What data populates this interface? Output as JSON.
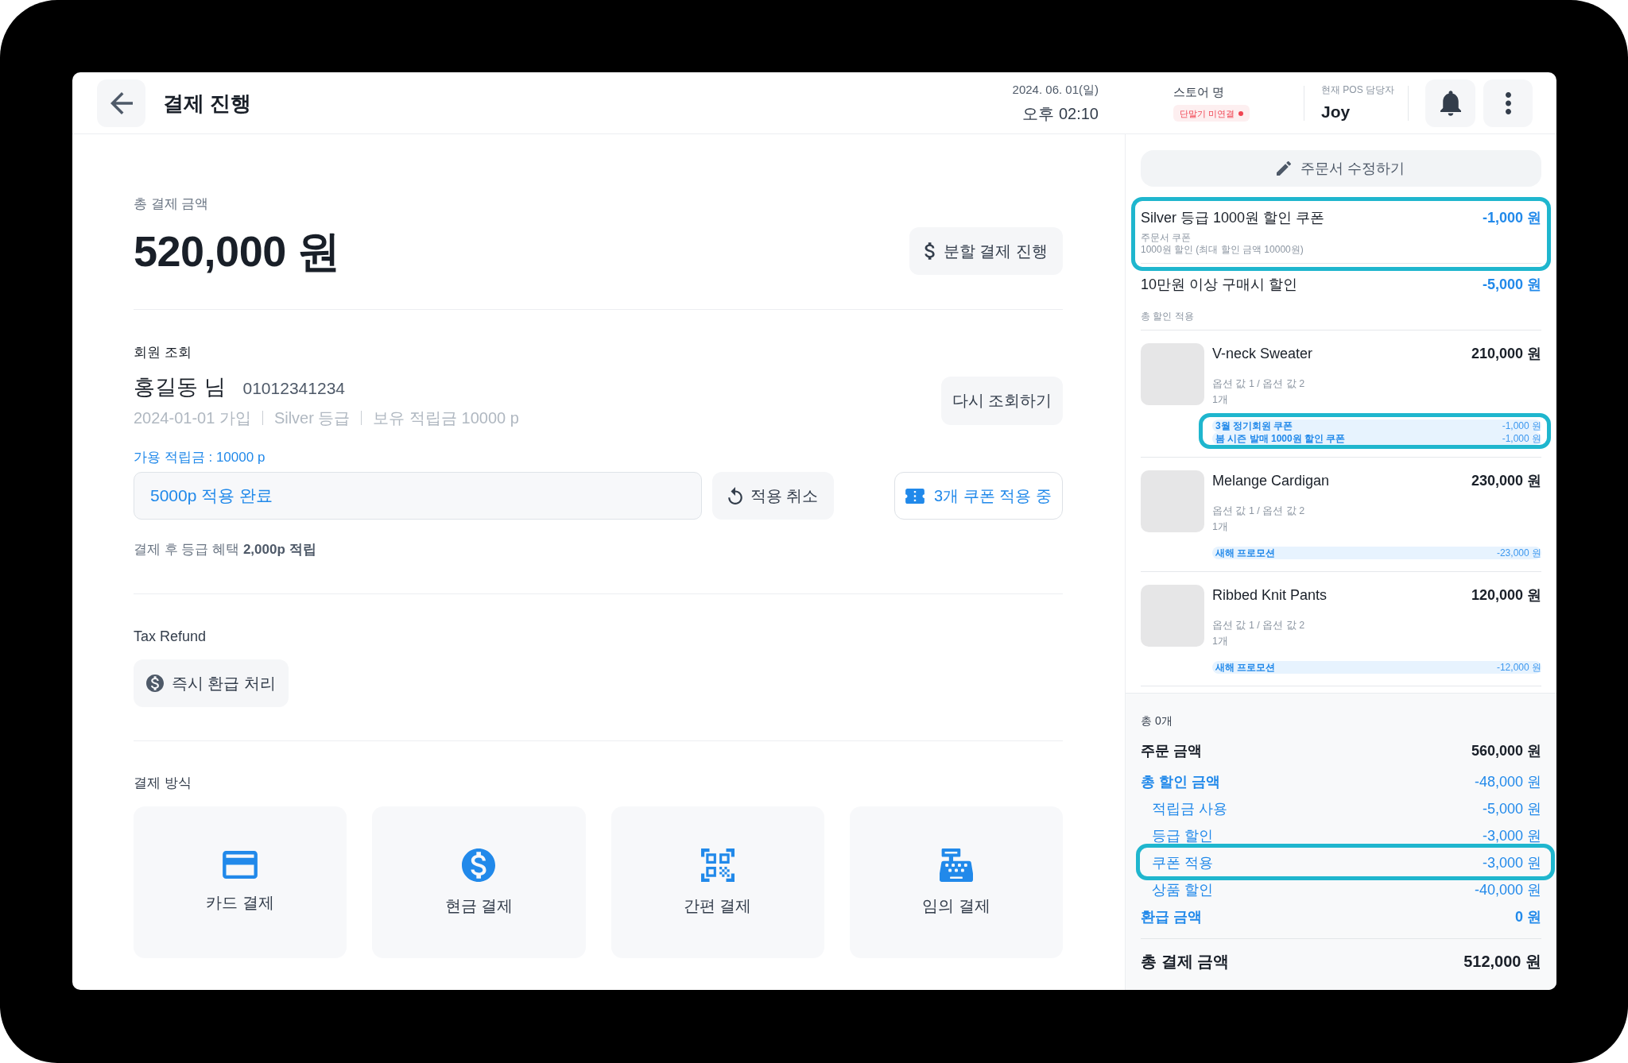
{
  "header": {
    "title": "결제 진행",
    "date": "2024. 06. 01(일)",
    "time": "오후 02:10",
    "store_name": "스토어 명",
    "terminal_status": {
      "label": "단말기 미연결",
      "connected": false
    },
    "staff_label": "현재 POS 담당자",
    "staff_name": "Joy"
  },
  "payment": {
    "label": "총 결제 금액",
    "amount": "520,000 원",
    "split_button": "분할 결제 진행"
  },
  "member": {
    "section_label": "회원 조회",
    "name": "홍길동 님",
    "phone": "01012341234",
    "details": [
      "2024-01-01 가입",
      "Silver 등급",
      "보유 적립금 10000 p"
    ],
    "lookup_button": "다시 조회하기",
    "points_label": "가용 적립금 : 10000 p",
    "points_field": {
      "value": "5000p 적용 완료"
    },
    "cancel_button": "적용 취소",
    "coupon_button": "3개 쿠폰 적용 중",
    "benefit_note": "결제 후 등급 혜택 **2,000p 적립**"
  },
  "tax_refund": {
    "label": "Tax Refund",
    "button": "즉시 환급 처리"
  },
  "payment_methods": {
    "label": "결제 방식",
    "items": [
      {
        "kind": "card",
        "label": "카드 결제"
      },
      {
        "kind": "cash",
        "label": "현금 결제"
      },
      {
        "kind": "qr",
        "label": "간편 결제"
      },
      {
        "kind": "register",
        "label": "임의 결제"
      }
    ]
  },
  "order_panel": {
    "edit_button": "주문서 수정하기",
    "discounts": [
      {
        "name": "Silver 등급 1000원 할인 쿠폰",
        "amount": "-1,000 원",
        "details": [
          "주문서 쿠폰",
          "1000원 할인 (최대 할인 금액 10000원)"
        ],
        "highlighted": true
      },
      {
        "name": "10만원 이상 구매시 할인",
        "amount": "-5,000 원",
        "details": [
          "총 할인 적용"
        ],
        "highlighted": false
      }
    ],
    "products": [
      {
        "name": "V-neck Sweater",
        "price": "210,000 원",
        "options": "옵션 값 1 / 옵션 값 2",
        "quantity": "1개",
        "discounts_highlighted": true,
        "discounts": [
          {
            "label": "3월 정기회원 쿠폰",
            "amount": "-1,000 원"
          },
          {
            "label": "봄 시즌 발매 1000원 할인 쿠폰",
            "amount": "-1,000 원"
          }
        ]
      },
      {
        "name": "Melange Cardigan",
        "price": "230,000 원",
        "options": "옵션 값 1 / 옵션 값 2",
        "quantity": "1개",
        "discounts_highlighted": false,
        "discounts": [
          {
            "label": "새해 프로모션",
            "amount": "-23,000 원"
          }
        ]
      },
      {
        "name": "Ribbed Knit Pants",
        "price": "120,000 원",
        "options": "옵션 값 1 / 옵션 값 2",
        "quantity": "1개",
        "discounts_highlighted": false,
        "discounts": [
          {
            "label": "새해 프로모션",
            "amount": "-12,000 원"
          }
        ]
      }
    ]
  },
  "order_summary": {
    "count": "총 0개",
    "rows": [
      {
        "kind": "main",
        "label": "주문 금액",
        "value": "560,000 원",
        "highlighted": false
      },
      {
        "kind": "discount_total",
        "label": "총 할인 금액",
        "value": "-48,000 원",
        "highlighted": false
      },
      {
        "kind": "sub",
        "label": "적립금 사용",
        "value": "-5,000 원",
        "highlighted": false
      },
      {
        "kind": "sub",
        "label": "등급 할인",
        "value": "-3,000 원",
        "highlighted": false
      },
      {
        "kind": "sub",
        "label": "쿠폰 적용",
        "value": "-3,000 원",
        "highlighted": true
      },
      {
        "kind": "sub",
        "label": "상품 할인",
        "value": "-40,000 원",
        "highlighted": false
      },
      {
        "kind": "refund",
        "label": "환급 금액",
        "value": "0 원",
        "highlighted": false
      }
    ],
    "total": {
      "label": "총 결제 금액",
      "value": "512,000 원"
    }
  }
}
